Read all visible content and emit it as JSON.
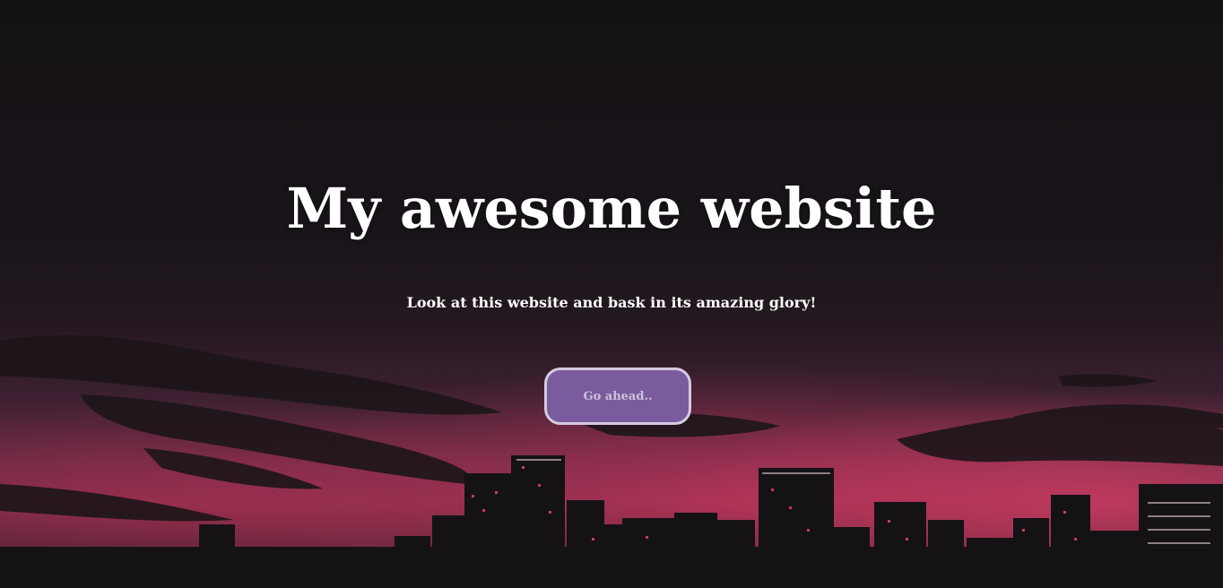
{
  "hero": {
    "title": "My awesome website",
    "subtitle": "Look at this website and bask in its amazing glory!",
    "cta_label": "Go ahead.."
  },
  "colors": {
    "button_bg": "#7a5c9e",
    "button_border": "#d6cbe0",
    "sky_top": "#141114",
    "sky_glow": "#d63860"
  }
}
